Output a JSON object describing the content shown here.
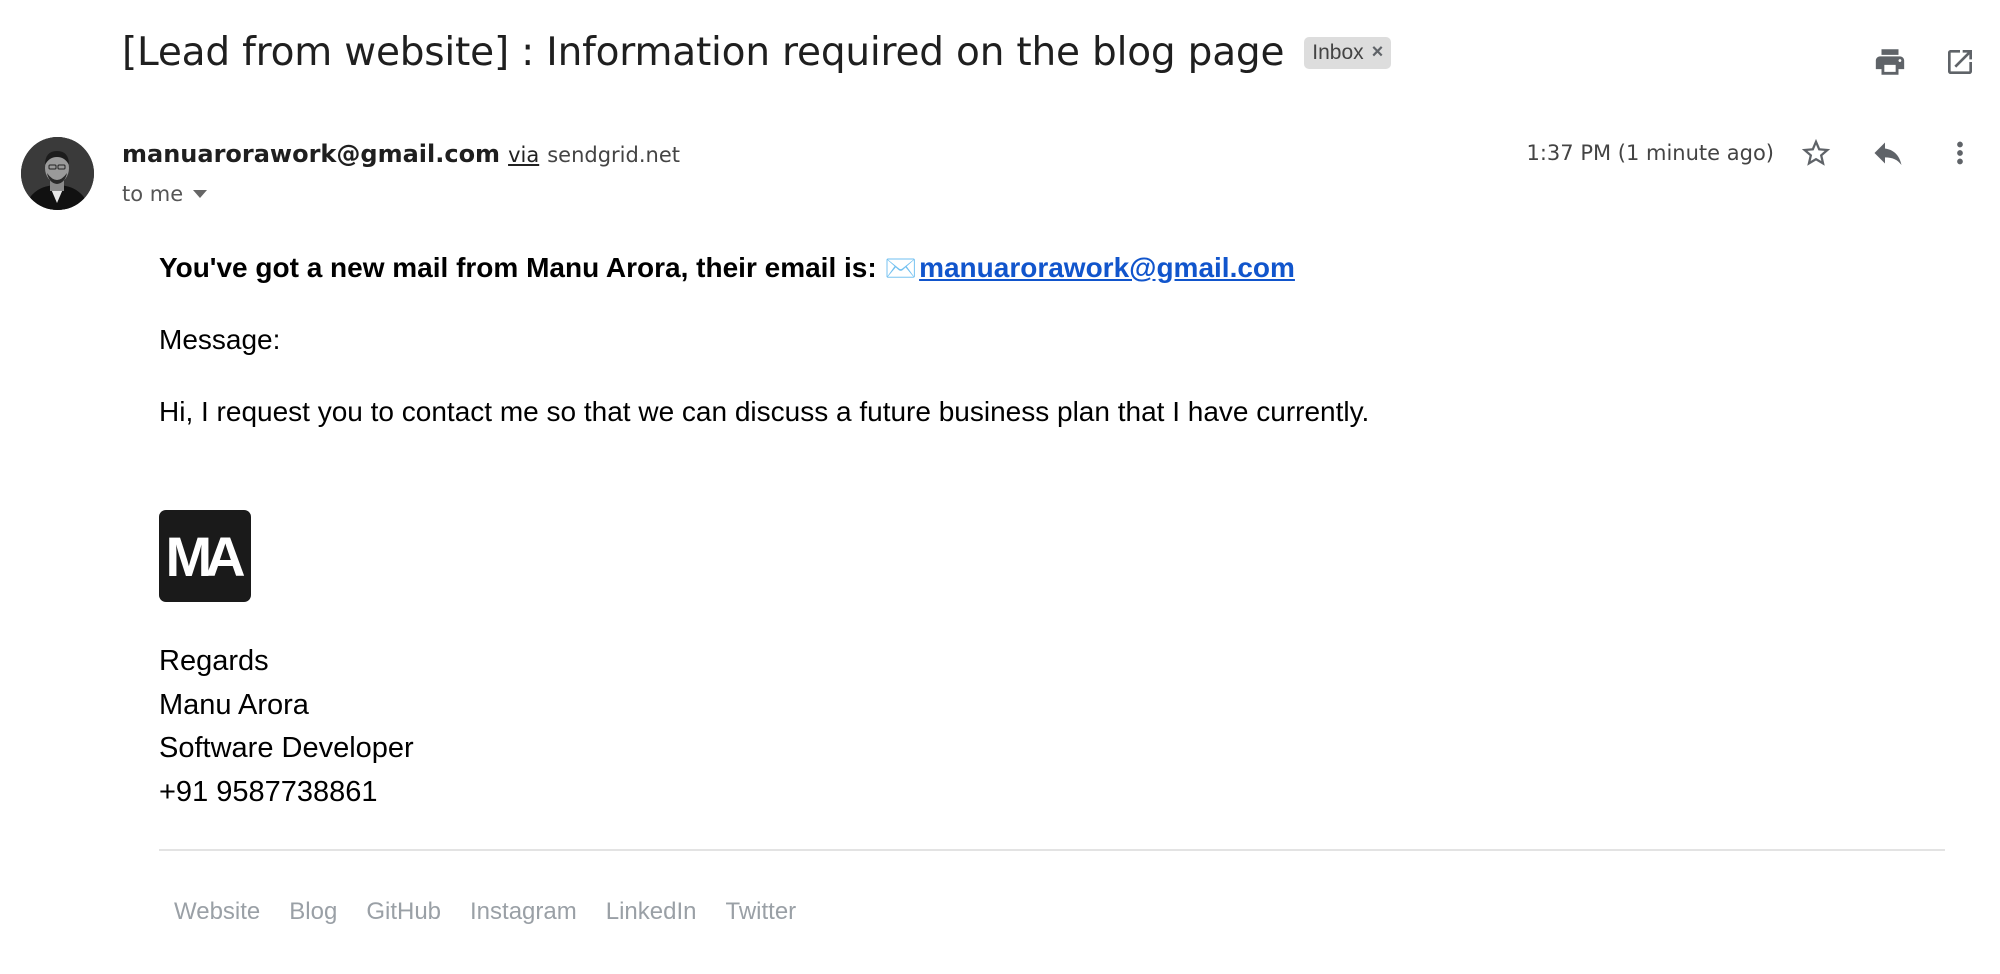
{
  "email": {
    "subject": "[Lead from website] : Information required on the blog page",
    "label": "Inbox",
    "label_remove": "×",
    "sender": {
      "email": "manuarorawork@gmail.com",
      "via": "via",
      "via_domain": "sendgrid.net",
      "to": "to me"
    },
    "timestamp": "1:37 PM (1 minute ago)",
    "body": {
      "intro": "You've got a new mail from Manu Arora, their email is:",
      "mail_emoji": "✉️",
      "intro_email": "manuarorawork@gmail.com",
      "message_label": "Message:",
      "message_text": "Hi, I request you to contact me so that we can discuss a future business plan that I have currently."
    },
    "logo_text": "MA",
    "signature": {
      "regards": "Regards",
      "name": "Manu Arora",
      "title": "Software Developer",
      "phone": "+91 9587738861"
    },
    "footer_links": [
      "Website",
      "Blog",
      "GitHub",
      "Instagram",
      "LinkedIn",
      "Twitter"
    ]
  },
  "icons": {
    "print": "print-icon",
    "open_new": "open-in-new-window-icon",
    "star": "star-icon",
    "reply": "reply-icon",
    "more": "more-vertical-icon",
    "caret": "chevron-down-icon"
  },
  "colors": {
    "link": "#1155cc",
    "footer_link": "#9aa0a6",
    "label_chip": "#dddddd"
  }
}
